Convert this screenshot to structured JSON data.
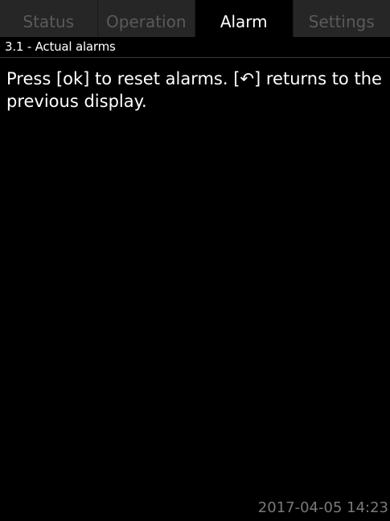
{
  "tabs": [
    {
      "label": "Status",
      "active": false
    },
    {
      "label": "Operation",
      "active": false
    },
    {
      "label": "Alarm",
      "active": true
    },
    {
      "label": "Settings",
      "active": false
    }
  ],
  "menu": {
    "title": "3.1 - Actual alarms"
  },
  "content": {
    "help_text": "Press [ok] to reset alarms. [↶] returns to the previous display."
  },
  "footer": {
    "datetime": "2017-04-05 14:23"
  },
  "colors": {
    "background": "#000000",
    "inactive_tab_bg": "#262626",
    "inactive_tab_text": "#5a5a5a",
    "active_tab_text": "#ffffff",
    "datetime_text": "#7a7a7a"
  }
}
